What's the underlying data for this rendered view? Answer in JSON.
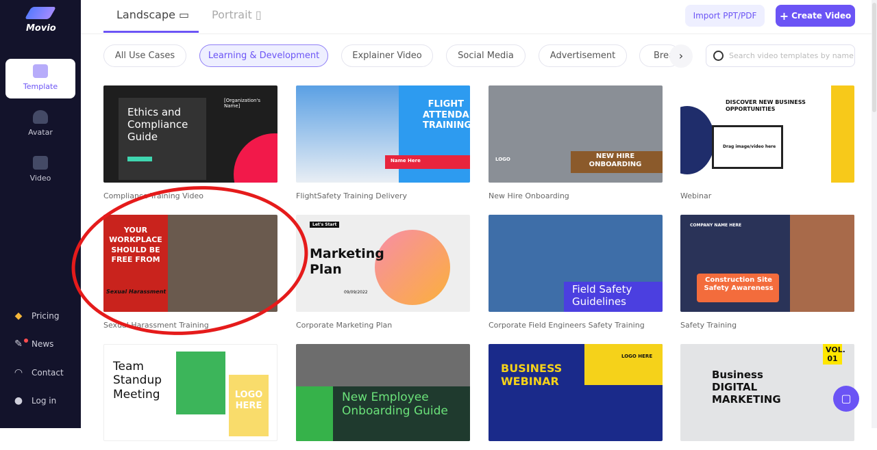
{
  "app": {
    "name": "Movio"
  },
  "sidebar": {
    "items": [
      {
        "label": "Template",
        "active": true
      },
      {
        "label": "Avatar"
      },
      {
        "label": "Video"
      }
    ],
    "bottom": [
      {
        "label": "Pricing"
      },
      {
        "label": "News"
      },
      {
        "label": "Contact"
      },
      {
        "label": "Log in"
      }
    ]
  },
  "header": {
    "tabs": [
      {
        "label": "Landscape",
        "active": true
      },
      {
        "label": "Portrait"
      }
    ],
    "import_label": "Import PPT/PDF",
    "create_label": "Create Video",
    "create_icon": "+"
  },
  "categories": [
    "All Use Cases",
    "Learning & Development",
    "Explainer Video",
    "Social Media",
    "Advertisement",
    "Brea"
  ],
  "search": {
    "placeholder": "Search video templates by name"
  },
  "accent": "#6b54f5",
  "templates": [
    {
      "caption": "Compliance Training Video",
      "thumb": "Ethics and Compliance Guide",
      "sub": "[Organization's Name]"
    },
    {
      "caption": "FlightSafety Training Delivery",
      "thumb": "FLIGHT ATTENDANT TRAINING",
      "sub": "Name Here"
    },
    {
      "caption": "New Hire Onboarding",
      "thumb": "NEW HIRE ONBOARDING",
      "sub": "LOGO"
    },
    {
      "caption": "Webinar",
      "thumb": "DISCOVER NEW BUSINESS OPPORTUNITIES",
      "sub": "Drag image/video here"
    },
    {
      "caption": "Sexual Harassment Training",
      "thumb": "YOUR WORKPLACE SHOULD BE FREE FROM",
      "sub": "Sexual Harassment"
    },
    {
      "caption": "Corporate Marketing Plan",
      "thumb": "Marketing Plan",
      "sub": "09/09/2022",
      "tag": "Let's Start"
    },
    {
      "caption": "Corporate Field Engineers Safety Training",
      "thumb": "Field Safety Guidelines"
    },
    {
      "caption": "Safety Training",
      "thumb": "Construction Site Safety Awareness",
      "sub": "COMPANY NAME HERE"
    },
    {
      "caption": "",
      "thumb": "Team Standup Meeting",
      "sub": "LOGO HERE"
    },
    {
      "caption": "",
      "thumb": "New Employee Onboarding Guide"
    },
    {
      "caption": "",
      "thumb": "BUSINESS WEBINAR",
      "sub": "LOGO HERE"
    },
    {
      "caption": "",
      "thumb": "Business DIGITAL MARKETING",
      "sub": "VOL. 01"
    }
  ]
}
